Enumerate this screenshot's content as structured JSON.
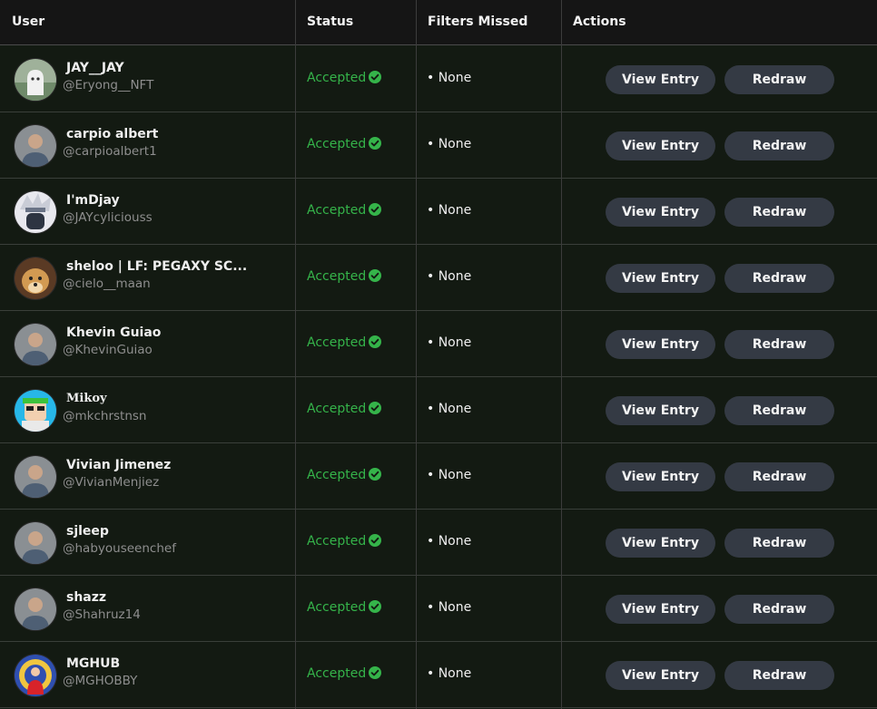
{
  "columns": {
    "user": "User",
    "status": "Status",
    "filters": "Filters Missed",
    "actions": "Actions"
  },
  "colors": {
    "accepted": "#35b44a",
    "button_bg": "#343a44",
    "header_bg": "#151515",
    "row_bg": "#131a12"
  },
  "rows": [
    {
      "name": "JAY__JAY",
      "handle": "@Eryong__NFT",
      "status": "Accepted",
      "filters": "• None",
      "view_label": "View Entry",
      "redraw_label": "Redraw",
      "avatar": "ghost-avatar"
    },
    {
      "name": "carpio albert",
      "handle": "@carpioalbert1",
      "status": "Accepted",
      "filters": "• None",
      "view_label": "View Entry",
      "redraw_label": "Redraw",
      "avatar": "person-avatar"
    },
    {
      "name": "I'mDjay",
      "handle": "@JAYcyliciouss",
      "status": "Accepted",
      "filters": "• None",
      "view_label": "View Entry",
      "redraw_label": "Redraw",
      "avatar": "anime-avatar"
    },
    {
      "name": "sheloo | LF: PEGAXY SC...",
      "handle": "@cielo__maan",
      "status": "Accepted",
      "filters": "• None",
      "view_label": "View Entry",
      "redraw_label": "Redraw",
      "avatar": "doge-avatar"
    },
    {
      "name": "Khevin Guiao",
      "handle": "@KhevinGuiao",
      "status": "Accepted",
      "filters": "• None",
      "view_label": "View Entry",
      "redraw_label": "Redraw",
      "avatar": "person-avatar"
    },
    {
      "name": "Mikoy",
      "handle": "@mkchrstnsn",
      "status": "Accepted",
      "filters": "• None",
      "view_label": "View Entry",
      "redraw_label": "Redraw",
      "avatar": "cartoon-avatar"
    },
    {
      "name": "Vivian Jimenez",
      "handle": "@VivianMenjiez",
      "status": "Accepted",
      "filters": "• None",
      "view_label": "View Entry",
      "redraw_label": "Redraw",
      "avatar": "person-avatar"
    },
    {
      "name": "sjleep",
      "handle": "@habyouseenchef",
      "status": "Accepted",
      "filters": "• None",
      "view_label": "View Entry",
      "redraw_label": "Redraw",
      "avatar": "person-avatar"
    },
    {
      "name": "shazz",
      "handle": "@Shahruz14",
      "status": "Accepted",
      "filters": "• None",
      "view_label": "View Entry",
      "redraw_label": "Redraw",
      "avatar": "person-avatar"
    },
    {
      "name": "MGHUB",
      "handle": "@MGHOBBY",
      "status": "Accepted",
      "filters": "• None",
      "view_label": "View Entry",
      "redraw_label": "Redraw",
      "avatar": "art-avatar"
    }
  ]
}
